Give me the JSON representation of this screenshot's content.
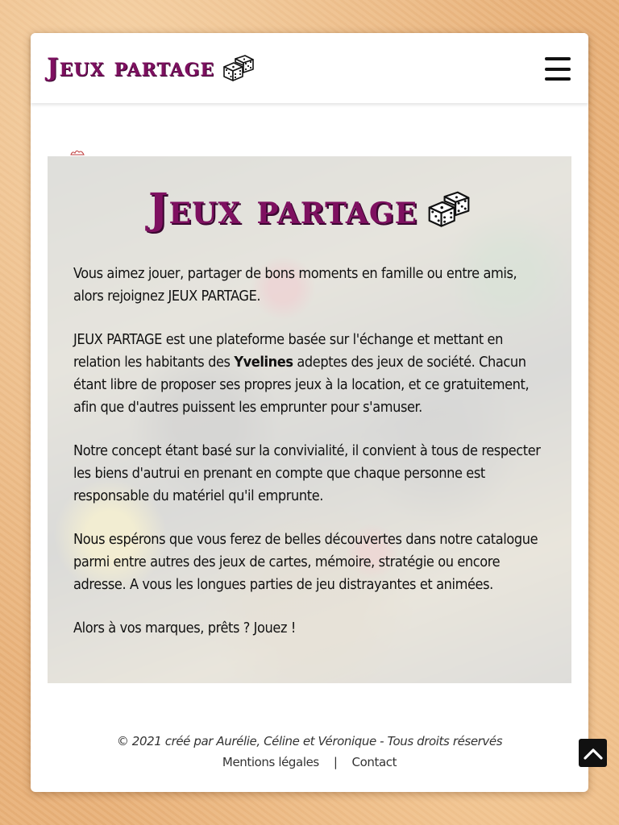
{
  "header": {
    "logo_text": "Jeux partage",
    "logo_icon": "dice-icon",
    "menu_icon": "hamburger-menu-icon"
  },
  "hero": {
    "title": "Jeux partage",
    "title_icon": "dice-icon",
    "p1": "Vous aimez jouer, partager de bons moments en famille ou entre amis, alors rejoignez JEUX PARTAGE.",
    "p2_before": "JEUX PARTAGE est une plateforme basée sur l'échange et mettant en relation les habitants des ",
    "p2_bold": "Yvelines",
    "p2_after": " adeptes des jeux de société. Chacun étant libre de proposer ses propres jeux à la location, et ce gratuitement, afin que d'autres puissent les emprunter pour s'amuser.",
    "p3": "Notre concept étant basé sur la convivialité, il convient à tous de respecter les biens d'autrui en prenant en compte que chaque personne est responsable du matériel qu'il emprunte.",
    "p4": "Nous espérons que vous ferez de belles découvertes dans notre catalogue parmi entre autres des jeux de cartes, mémoire, stratégie ou encore adresse. A vous les longues parties de jeu distrayantes et animées.",
    "p5": "Alors à vos marques, prêts ? Jouez !"
  },
  "footer": {
    "copyright": "© 2021 créé par Aurélie, Céline et Véronique - Tous droits réservés",
    "legal_link": "Mentions légales",
    "separator": "|",
    "contact_link": "Contact"
  },
  "scroll_top": {
    "icon": "chevron-up-icon"
  },
  "colors": {
    "brand": "#7e1060",
    "background": "#e9b27a"
  }
}
